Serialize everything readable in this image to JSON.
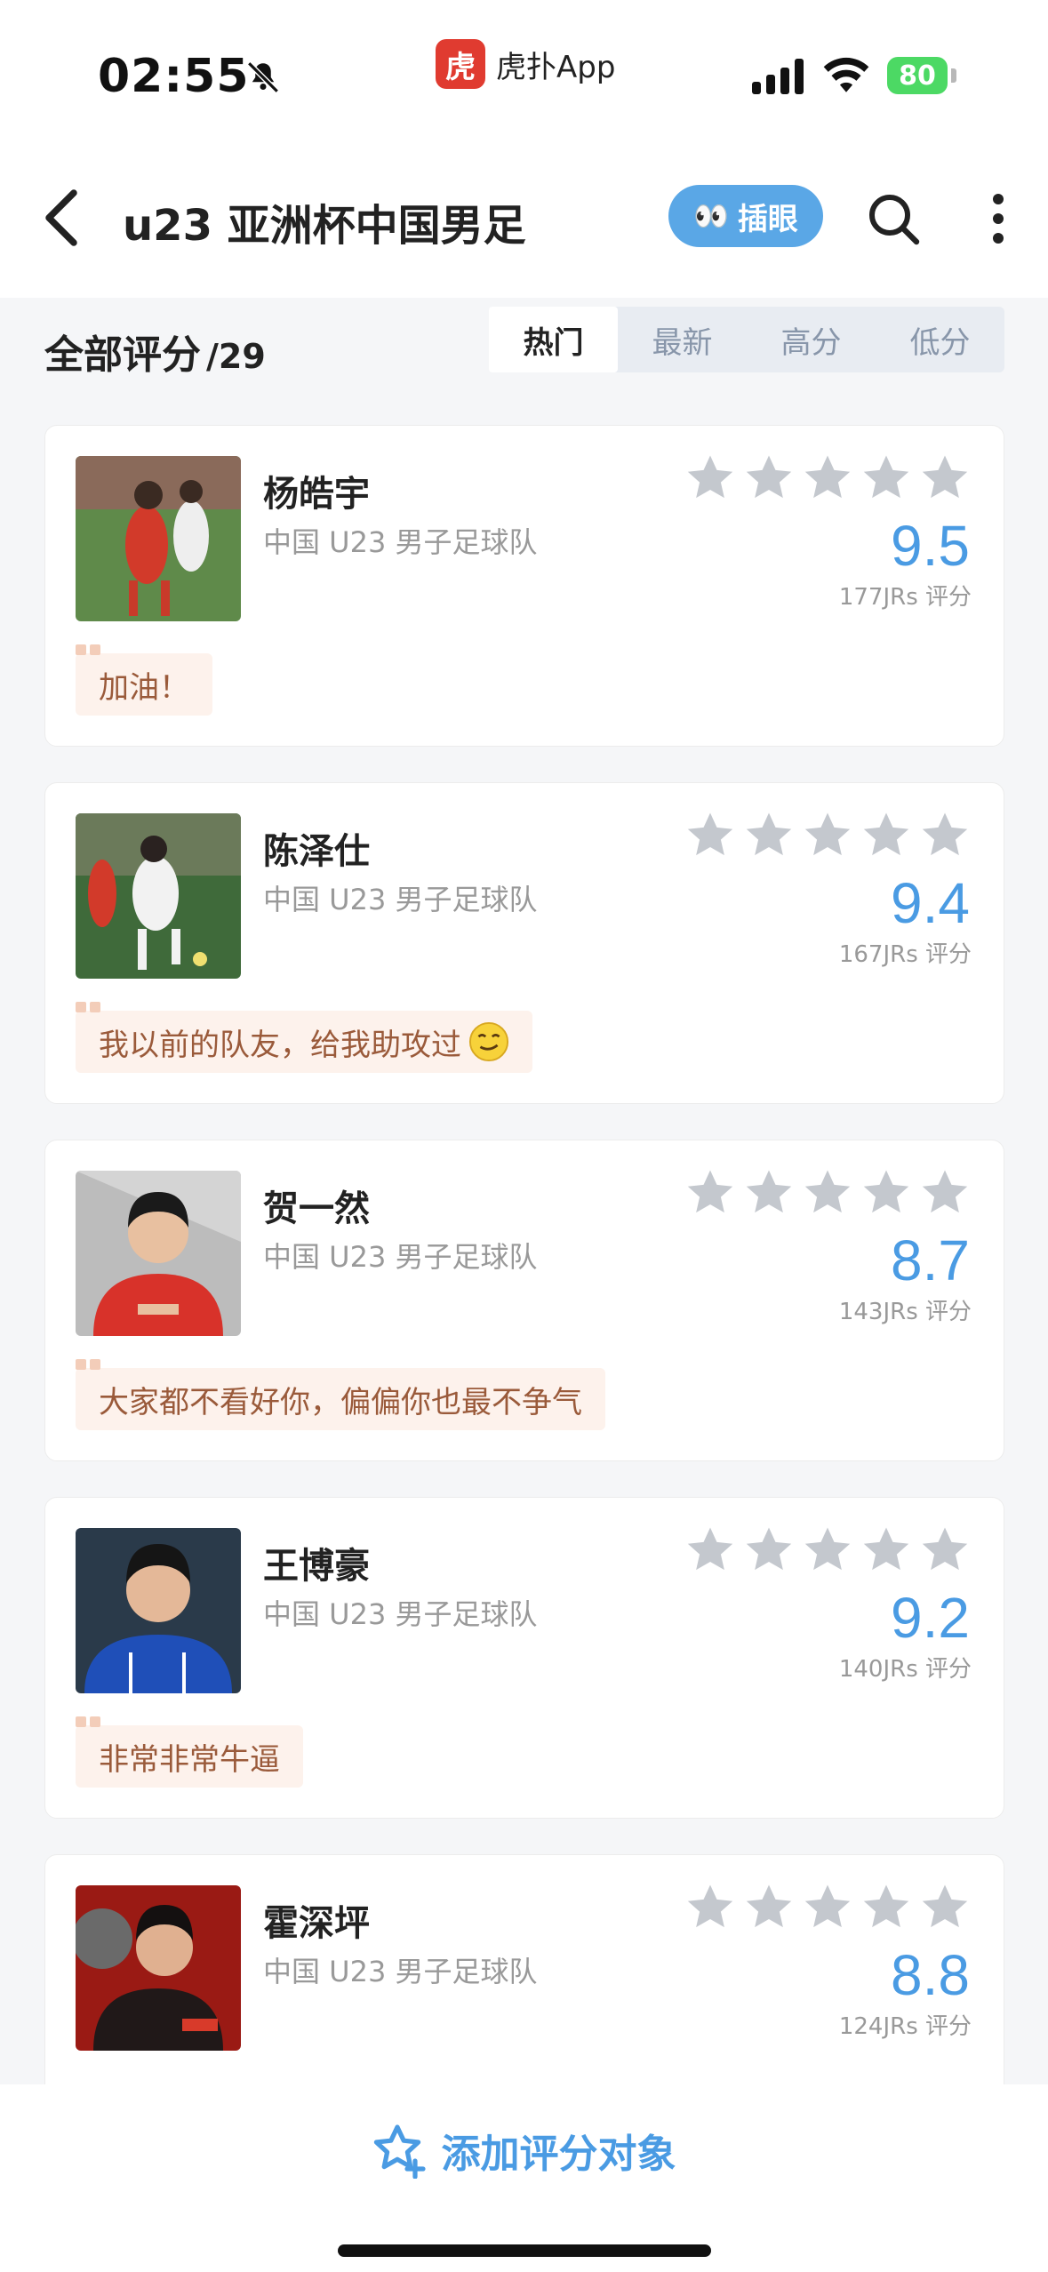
{
  "status": {
    "time": "02:55",
    "app_name": "虎扑App",
    "app_logo_text": "虎",
    "battery": "80"
  },
  "nav": {
    "title": "u23 亚洲杯中国男足",
    "chayan_label": "插眼"
  },
  "header": {
    "title": "全部评分",
    "count": "/29",
    "tabs": [
      "热门",
      "最新",
      "高分",
      "低分"
    ],
    "active_tab": "热门"
  },
  "players": [
    {
      "name": "杨皓宇",
      "team": "中国 U23 男子足球队",
      "score": "9.5",
      "votes": "177JRs 评分",
      "comment": "加油！"
    },
    {
      "name": "陈泽仕",
      "team": "中国 U23 男子足球队",
      "score": "9.4",
      "votes": "167JRs 评分",
      "comment": "我以前的队友，给我助攻过"
    },
    {
      "name": "贺一然",
      "team": "中国 U23 男子足球队",
      "score": "8.7",
      "votes": "143JRs 评分",
      "comment": "大家都不看好你，偏偏你也最不争气"
    },
    {
      "name": "王博豪",
      "team": "中国 U23 男子足球队",
      "score": "9.2",
      "votes": "140JRs 评分",
      "comment": "非常非常牛逼"
    },
    {
      "name": "霍深坪",
      "team": "中国 U23 男子足球队",
      "score": "8.8",
      "votes": "124JRs 评分",
      "comment": ""
    }
  ],
  "bottom": {
    "add_label": "添加评分对象"
  },
  "colors": {
    "accent": "#4a9be3",
    "chayan_bg": "#5aa7e6",
    "comment_bg": "#fdf2ec",
    "comment_text": "#9a5a3a",
    "star_gray": "#c4c8ce"
  }
}
